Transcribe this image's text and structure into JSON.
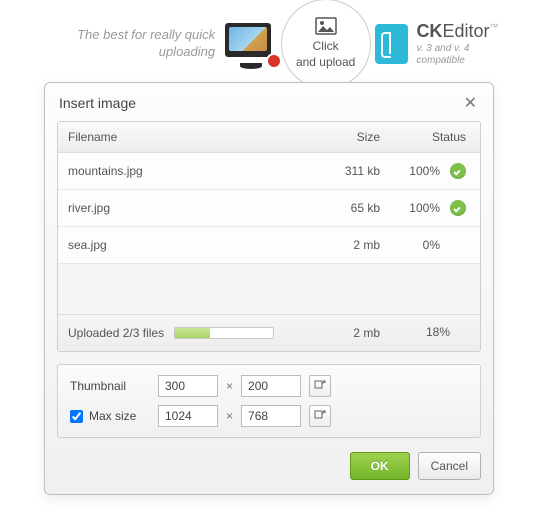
{
  "header": {
    "tagline": "The best for really quick uploading",
    "upload_label_line1": "Click",
    "upload_label_line2": "and upload",
    "brand_prefix": "CK",
    "brand_suffix": "Editor",
    "tm": "™",
    "compat": "v. 3 and v. 4 compatible"
  },
  "dialog": {
    "title": "Insert image",
    "columns": {
      "filename": "Filename",
      "size": "Size",
      "status": "Status"
    },
    "rows": [
      {
        "filename": "mountains.jpg",
        "size": "311 kb",
        "percent": "100%",
        "done": true
      },
      {
        "filename": "river.jpg",
        "size": "65 kb",
        "percent": "100%",
        "done": true
      },
      {
        "filename": "sea.jpg",
        "size": "2 mb",
        "percent": "0%",
        "done": false
      }
    ],
    "summary": {
      "label": "Uploaded",
      "count": "2/3 files",
      "total_size": "2 mb",
      "total_percent": "18%"
    },
    "options": {
      "thumbnail_label": "Thumbnail",
      "thumbnail_w": "300",
      "thumbnail_h": "200",
      "maxsize_label": "Max size",
      "maxsize_checked": true,
      "maxsize_w": "1024",
      "maxsize_h": "768",
      "times": "×"
    },
    "buttons": {
      "ok": "OK",
      "cancel": "Cancel"
    }
  }
}
